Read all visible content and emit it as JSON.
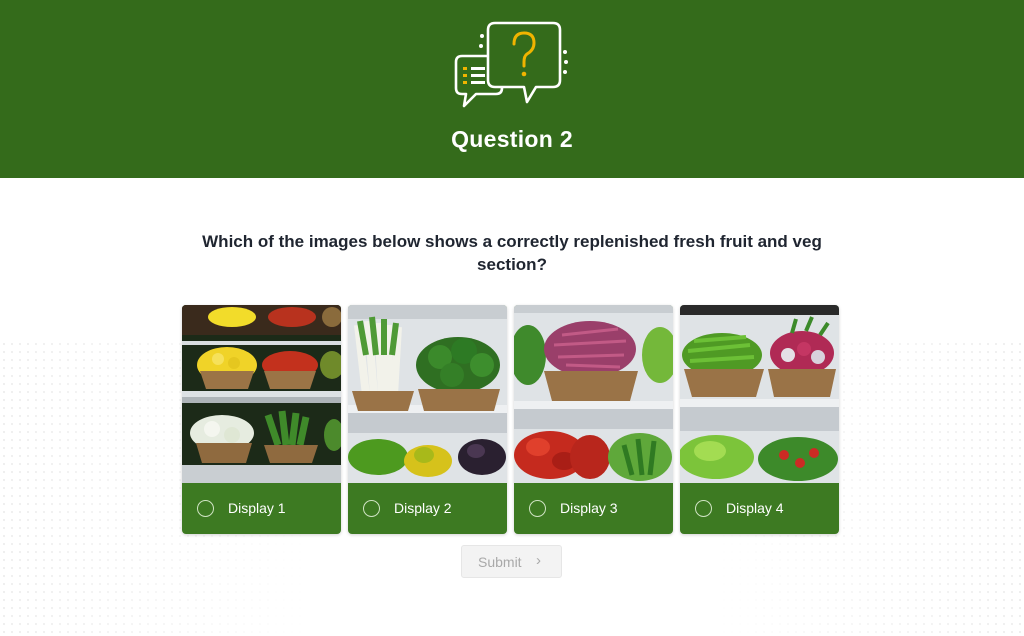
{
  "header": {
    "title": "Question 2",
    "icon": "speech-bubbles-question-icon",
    "background_color": "#346b1b",
    "accent_color": "#f0b400"
  },
  "question": {
    "text": "Which of the images below shows a correctly replenished fresh fruit and veg section?"
  },
  "options": [
    {
      "label": "Display 1",
      "image": "produce-shelves-lemons-chillies-cauliflower"
    },
    {
      "label": "Display 2",
      "image": "produce-shelves-leeks-broccoli-peppers"
    },
    {
      "label": "Display 3",
      "image": "produce-shelves-beans-red-peppers"
    },
    {
      "label": "Display 4",
      "image": "produce-shelves-green-chillies-radishes-lettuce"
    }
  ],
  "submit": {
    "label": "Submit",
    "icon": "chevron-right-icon"
  },
  "colors": {
    "card_footer": "#3d7a22",
    "text_dark": "#1f2530"
  }
}
